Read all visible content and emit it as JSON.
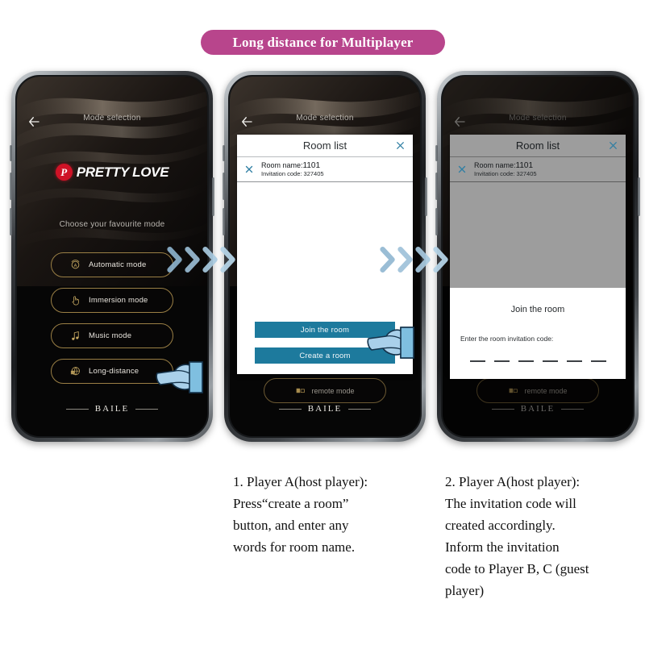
{
  "banner": {
    "title": "Long distance for Multiplayer",
    "color": "#b8458c"
  },
  "phones": {
    "nav": {
      "title": "Mode selection",
      "back_icon": "arrow-left-icon"
    },
    "brand": {
      "badge": "P",
      "name": "PRETTY LOVE",
      "badge_color": "#cf1226"
    },
    "prompt": "Choose your favourite mode",
    "modes": [
      {
        "label": "Automatic mode",
        "icon": "automatic-mode-icon"
      },
      {
        "label": "Immersion mode",
        "icon": "hand-touch-icon"
      },
      {
        "label": "Music mode",
        "icon": "music-note-icon"
      },
      {
        "label": "Long-distance",
        "icon": "globe-icon"
      }
    ],
    "remote_mode": {
      "label": "remote mode",
      "icon": "remote-control-icon"
    },
    "footer": "BAILE"
  },
  "dialog": {
    "title": "Room list",
    "close_icon": "close-icon",
    "room": {
      "name_label": "Room name:",
      "name_value": "1101",
      "code_label": "Invitation code:",
      "code_value": "327405",
      "remove_icon": "close-icon"
    },
    "buttons": {
      "join": "Join the room",
      "create": "Create a room"
    },
    "accent_color": "#1d7a9d"
  },
  "join_modal": {
    "title": "Join the room",
    "prompt": "Enter the room invitation code:",
    "slot_count": 6
  },
  "captions": [
    "1. Player A(host player):\nPress“create a room”\nbutton, and enter any\nwords for room name.",
    "2. Player A(host player):\nThe invitation code will\ncreated accordingly.\nInform the invitation\ncode to Player B, C (guest\nplayer)"
  ],
  "cursors": {
    "pointing_hand_icon": "pointing-hand-icon",
    "color": "#9ecbe8"
  },
  "arrows": {
    "icon": "chevron-right-icon",
    "color": "#9cc5de"
  }
}
